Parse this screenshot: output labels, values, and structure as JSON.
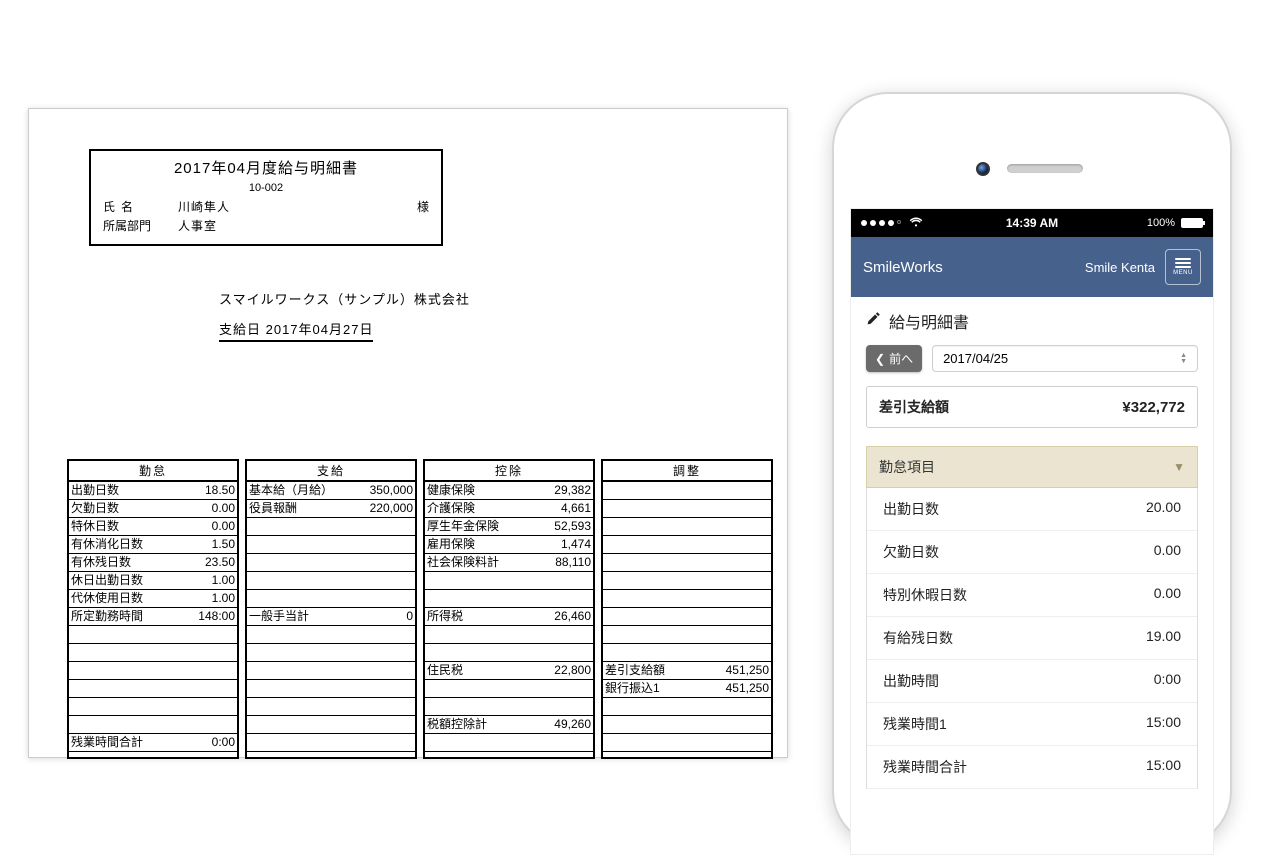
{
  "paper": {
    "title": "2017年04月度給与明細書",
    "emp_id": "10-002",
    "name_label": "氏名",
    "name_value": "川崎隼人",
    "name_suffix": "様",
    "dept_label": "所属部門",
    "dept_value": "人事室",
    "company": "スマイルワークス（サンプル）株式会社",
    "paydate": "支給日  2017年04月27日",
    "columns": [
      {
        "header": "勤怠",
        "rows": [
          {
            "l": "出勤日数",
            "r": "18.50"
          },
          {
            "l": "欠勤日数",
            "r": "0.00"
          },
          {
            "l": "特休日数",
            "r": "0.00"
          },
          {
            "l": "有休消化日数",
            "r": "1.50"
          },
          {
            "l": "有休残日数",
            "r": "23.50"
          },
          {
            "l": "休日出勤日数",
            "r": "1.00"
          },
          {
            "l": "代休使用日数",
            "r": "1.00"
          },
          {
            "l": "所定勤務時間",
            "r": "148:00"
          },
          {
            "l": "",
            "r": ""
          },
          {
            "l": "",
            "r": ""
          },
          {
            "l": "",
            "r": ""
          },
          {
            "l": "",
            "r": ""
          },
          {
            "l": "",
            "r": ""
          },
          {
            "l": "",
            "r": ""
          },
          {
            "l": "残業時間合計",
            "r": "0:00"
          },
          {
            "l": "",
            "r": ""
          }
        ]
      },
      {
        "header": "支給",
        "rows": [
          {
            "l": "基本給（月給）",
            "r": "350,000"
          },
          {
            "l": "役員報酬",
            "r": "220,000"
          },
          {
            "l": "",
            "r": ""
          },
          {
            "l": "",
            "r": ""
          },
          {
            "l": "",
            "r": ""
          },
          {
            "l": "",
            "r": ""
          },
          {
            "l": "",
            "r": ""
          },
          {
            "l": "一般手当計",
            "r": "0"
          },
          {
            "l": "",
            "r": ""
          },
          {
            "l": "",
            "r": ""
          },
          {
            "l": "",
            "r": ""
          },
          {
            "l": "",
            "r": ""
          },
          {
            "l": "",
            "r": ""
          },
          {
            "l": "",
            "r": ""
          },
          {
            "l": "",
            "r": ""
          },
          {
            "l": "",
            "r": ""
          }
        ]
      },
      {
        "header": "控除",
        "rows": [
          {
            "l": "健康保険",
            "r": "29,382"
          },
          {
            "l": "介護保険",
            "r": "4,661"
          },
          {
            "l": "厚生年金保険",
            "r": "52,593"
          },
          {
            "l": "雇用保険",
            "r": "1,474"
          },
          {
            "l": "社会保険料計",
            "r": "88,110"
          },
          {
            "l": "",
            "r": ""
          },
          {
            "l": "",
            "r": ""
          },
          {
            "l": "所得税",
            "r": "26,460"
          },
          {
            "l": "",
            "r": ""
          },
          {
            "l": "",
            "r": ""
          },
          {
            "l": "住民税",
            "r": "22,800"
          },
          {
            "l": "",
            "r": ""
          },
          {
            "l": "",
            "r": ""
          },
          {
            "l": "税額控除計",
            "r": "49,260"
          },
          {
            "l": "",
            "r": ""
          },
          {
            "l": "",
            "r": ""
          }
        ]
      },
      {
        "header": "調整",
        "rows": [
          {
            "l": "",
            "r": ""
          },
          {
            "l": "",
            "r": ""
          },
          {
            "l": "",
            "r": ""
          },
          {
            "l": "",
            "r": ""
          },
          {
            "l": "",
            "r": ""
          },
          {
            "l": "",
            "r": ""
          },
          {
            "l": "",
            "r": ""
          },
          {
            "l": "",
            "r": ""
          },
          {
            "l": "",
            "r": ""
          },
          {
            "l": "",
            "r": ""
          },
          {
            "l": "差引支給額",
            "r": "451,250"
          },
          {
            "l": "銀行振込1",
            "r": "451,250"
          },
          {
            "l": "",
            "r": ""
          },
          {
            "l": "",
            "r": ""
          },
          {
            "l": "",
            "r": ""
          },
          {
            "l": "",
            "r": ""
          }
        ]
      }
    ]
  },
  "phone": {
    "status": {
      "time": "14:39 AM",
      "battery": "100%"
    },
    "app": {
      "brand": "SmileWorks",
      "user": "Smile Kenta",
      "menu_label": "MENU"
    },
    "page_title": "給与明細書",
    "prev_label": "前へ",
    "date_value": "2017/04/25",
    "netpay": {
      "label": "差引支給額",
      "value": "¥322,772"
    },
    "section_header": "勤怠項目",
    "rows": [
      {
        "l": "出勤日数",
        "r": "20.00"
      },
      {
        "l": "欠勤日数",
        "r": "0.00"
      },
      {
        "l": "特別休暇日数",
        "r": "0.00"
      },
      {
        "l": "有給残日数",
        "r": "19.00"
      },
      {
        "l": "出勤時間",
        "r": "0:00"
      },
      {
        "l": "残業時間1",
        "r": "15:00"
      },
      {
        "l": "残業時間合計",
        "r": "15:00"
      }
    ]
  }
}
